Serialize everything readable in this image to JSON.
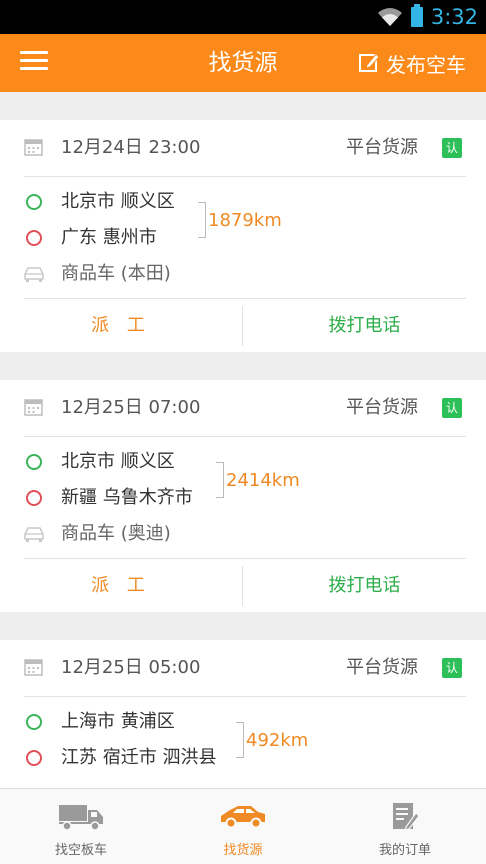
{
  "status_bar": {
    "time": "3:32"
  },
  "app_bar": {
    "title": "找货源",
    "publish_label": "发布空车"
  },
  "cards": [
    {
      "date": "12月24日 23:00",
      "source": "平台货源",
      "badge": "认",
      "origin": "北京市 顺义区",
      "destination": "广东 惠州市",
      "distance": "1879km",
      "vehicle": "商品车 (本田)",
      "dispatch_label": "派 工",
      "call_label": "拨打电话"
    },
    {
      "date": "12月25日 07:00",
      "source": "平台货源",
      "badge": "认",
      "origin": "北京市 顺义区",
      "destination": "新疆 乌鲁木齐市",
      "distance": "2414km",
      "vehicle": "商品车 (奥迪)",
      "dispatch_label": "派 工",
      "call_label": "拨打电话"
    },
    {
      "date": "12月25日 05:00",
      "source": "平台货源",
      "badge": "认",
      "origin": "上海市 黄浦区",
      "destination": "江苏 宿迁市 泗洪县",
      "distance": "492km",
      "vehicle": "",
      "dispatch_label": "",
      "call_label": ""
    }
  ],
  "tabs": [
    {
      "label": "找空板车",
      "icon": "truck-icon"
    },
    {
      "label": "找货源",
      "icon": "car-icon"
    },
    {
      "label": "我的订单",
      "icon": "order-list-icon"
    }
  ],
  "colors": {
    "accent": "#fb8a1a",
    "call_green": "#2dae4a",
    "badge_green": "#2dbf58",
    "origin_dot": "#3bb55c",
    "dest_dot": "#e0505a"
  }
}
